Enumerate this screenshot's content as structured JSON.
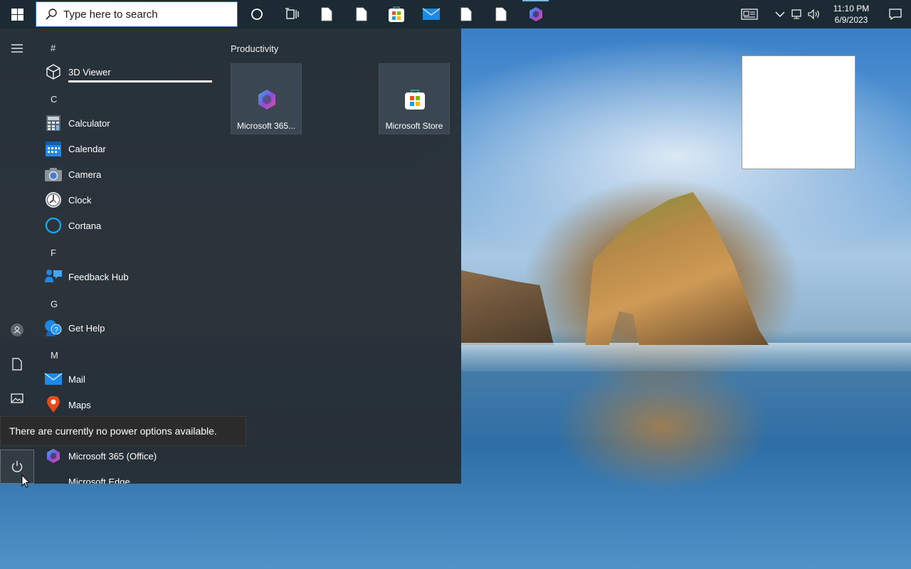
{
  "taskbar": {
    "search_placeholder": "Type here to search",
    "pinned": [
      {
        "name": "cortana-circle-icon"
      },
      {
        "name": "task-view-icon"
      },
      {
        "name": "file-icon"
      },
      {
        "name": "file-icon"
      },
      {
        "name": "microsoft-store-icon"
      },
      {
        "name": "mail-icon"
      },
      {
        "name": "file-icon"
      },
      {
        "name": "file-icon"
      },
      {
        "name": "microsoft-365-icon",
        "active": true
      }
    ],
    "clock": {
      "time": "11:10 PM",
      "date": "6/9/2023"
    }
  },
  "start_menu": {
    "apps": [
      {
        "type": "letter",
        "text": "#"
      },
      {
        "type": "app",
        "label": "3D Viewer",
        "icon": "3d-viewer-icon"
      },
      {
        "type": "letter",
        "text": "C"
      },
      {
        "type": "app",
        "label": "Calculator",
        "icon": "calculator-icon"
      },
      {
        "type": "app",
        "label": "Calendar",
        "icon": "calendar-icon"
      },
      {
        "type": "app",
        "label": "Camera",
        "icon": "camera-icon"
      },
      {
        "type": "app",
        "label": "Clock",
        "icon": "clock-icon"
      },
      {
        "type": "app",
        "label": "Cortana",
        "icon": "cortana-icon"
      },
      {
        "type": "letter",
        "text": "F"
      },
      {
        "type": "app",
        "label": "Feedback Hub",
        "icon": "feedback-hub-icon"
      },
      {
        "type": "letter",
        "text": "G"
      },
      {
        "type": "app",
        "label": "Get Help",
        "icon": "get-help-icon"
      },
      {
        "type": "letter",
        "text": "M"
      },
      {
        "type": "app",
        "label": "Mail",
        "icon": "mail-icon"
      },
      {
        "type": "app",
        "label": "Maps",
        "icon": "maps-icon"
      },
      {
        "type": "app",
        "label": "Microsoft 365 (Office)",
        "icon": "microsoft-365-icon"
      },
      {
        "type": "app",
        "label": "Microsoft Edge",
        "icon": "edge-icon"
      }
    ],
    "tiles_group": "Productivity",
    "tiles": [
      {
        "label": "Microsoft 365...",
        "icon": "microsoft-365-icon"
      },
      {
        "label": "Microsoft Store",
        "icon": "microsoft-store-icon"
      }
    ],
    "power_tooltip": "There are currently no power options available."
  },
  "colors": {
    "taskbar_bg": "#1c2a33",
    "start_bg": "#262e34",
    "accent": "#2a73c9"
  }
}
